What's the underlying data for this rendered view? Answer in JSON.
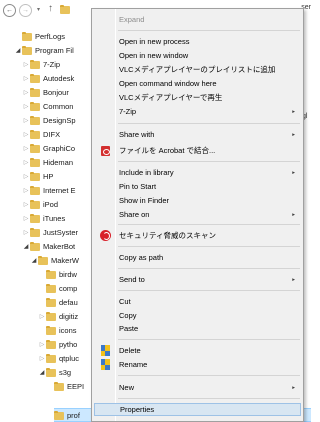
{
  "navbar": {
    "back_glyph": "←",
    "forward_glyph": "→",
    "dropdown_glyph": "▾",
    "up_glyph": "↑",
    "address_tail": "ser"
  },
  "background_text": {
    "right_1": "ser",
    "right_2": "gl"
  },
  "tree": {
    "items": [
      {
        "label": "PerfLogs",
        "arrow": ""
      },
      {
        "label": "Program Fil",
        "arrow": "◢"
      },
      {
        "label": "7-Zip",
        "arrow": "▷"
      },
      {
        "label": "Autodesk",
        "arrow": "▷"
      },
      {
        "label": "Bonjour",
        "arrow": "▷"
      },
      {
        "label": "Common",
        "arrow": "▷"
      },
      {
        "label": "DesignSp",
        "arrow": "▷"
      },
      {
        "label": "DIFX",
        "arrow": "▷"
      },
      {
        "label": "GraphiCo",
        "arrow": "▷"
      },
      {
        "label": "Hideman",
        "arrow": "▷"
      },
      {
        "label": "HP",
        "arrow": "▷"
      },
      {
        "label": "Internet E",
        "arrow": "▷"
      },
      {
        "label": "iPod",
        "arrow": "▷"
      },
      {
        "label": "iTunes",
        "arrow": "▷"
      },
      {
        "label": "JustSyster",
        "arrow": "▷"
      },
      {
        "label": "MakerBot",
        "arrow": "◢"
      },
      {
        "label": "MakerW",
        "arrow": "◢"
      },
      {
        "label": "birdw",
        "arrow": ""
      },
      {
        "label": "comp",
        "arrow": ""
      },
      {
        "label": "defau",
        "arrow": ""
      },
      {
        "label": "digitiz",
        "arrow": "▷"
      },
      {
        "label": "icons",
        "arrow": ""
      },
      {
        "label": "pytho",
        "arrow": "▷"
      },
      {
        "label": "qtpluc",
        "arrow": "▷"
      },
      {
        "label": "s3g",
        "arrow": "◢"
      },
      {
        "label": "EEPI",
        "arrow": ""
      },
      {
        "label": "prof",
        "arrow": ""
      }
    ]
  },
  "context_menu": {
    "items": [
      {
        "label": "Expand",
        "disabled": true
      },
      {
        "label": "Open in new process"
      },
      {
        "label": "Open in new window"
      },
      {
        "label": "VLCメディアプレイヤーのプレイリストに追加"
      },
      {
        "label": "Open command window here"
      },
      {
        "label": "VLCメディアプレイヤーで再生"
      },
      {
        "label": "7-Zip",
        "submenu": "▸"
      },
      {
        "label": "Share with",
        "submenu": "▸"
      },
      {
        "label": "ファイルを Acrobat で結合...",
        "icon": "acrobat-pdf-icon"
      },
      {
        "label": "Include in library",
        "submenu": "▸"
      },
      {
        "label": "Pin to Start"
      },
      {
        "label": "Show in Finder"
      },
      {
        "label": "Share on",
        "submenu": "▸"
      },
      {
        "label": "セキュリティ脅威のスキャン",
        "icon": "security-scan-icon"
      },
      {
        "label": "Copy as path"
      },
      {
        "label": "Send to",
        "submenu": "▸"
      },
      {
        "label": "Cut"
      },
      {
        "label": "Copy"
      },
      {
        "label": "Paste"
      },
      {
        "label": "Delete",
        "icon": "shield-icon"
      },
      {
        "label": "Rename",
        "icon": "shield-icon"
      },
      {
        "label": "New",
        "submenu": "▸"
      },
      {
        "label": "Properties",
        "hover": true
      }
    ]
  },
  "colors": {
    "menu_bg": "#f0f0f0",
    "menu_hover": "#d8e6f2",
    "tree_selection": "#cce8ff",
    "folder": "#e8c25a"
  }
}
